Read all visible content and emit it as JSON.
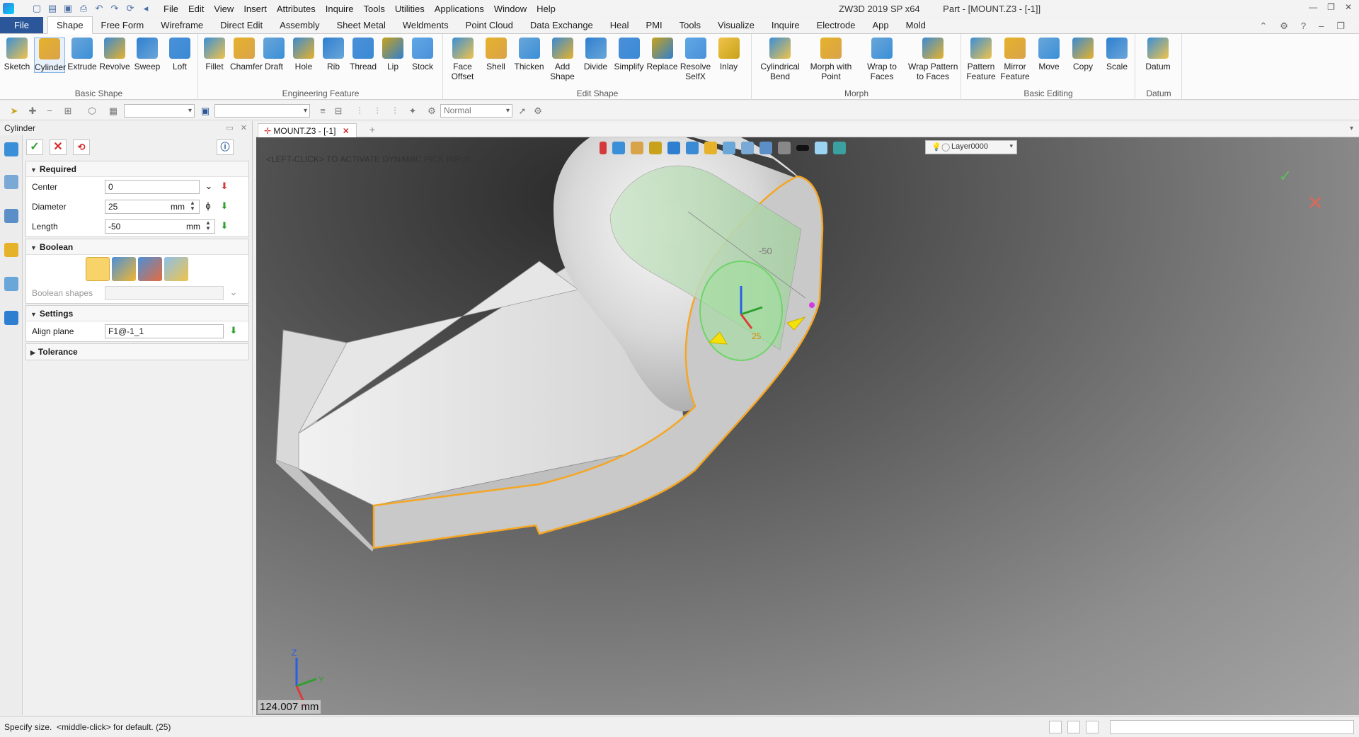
{
  "titlebar": {
    "menus": [
      "File",
      "Edit",
      "View",
      "Insert",
      "Attributes",
      "Inquire",
      "Tools",
      "Utilities",
      "Applications",
      "Window",
      "Help"
    ],
    "app_title": "ZW3D 2019 SP x64",
    "doc_title": "Part - [MOUNT.Z3 - [-1]]"
  },
  "ribbon_tabs": [
    "File",
    "Shape",
    "Free Form",
    "Wireframe",
    "Direct Edit",
    "Assembly",
    "Sheet Metal",
    "Weldments",
    "Point Cloud",
    "Data Exchange",
    "Heal",
    "PMI",
    "Tools",
    "Visualize",
    "Inquire",
    "Electrode",
    "App",
    "Mold"
  ],
  "ribbon": {
    "basic_shape": {
      "label": "Basic Shape",
      "tools": [
        "Sketch",
        "Cylinder",
        "Extrude",
        "Revolve",
        "Sweep",
        "Loft"
      ]
    },
    "engineering_feature": {
      "label": "Engineering Feature",
      "tools": [
        "Fillet",
        "Chamfer",
        "Draft",
        "Hole",
        "Rib",
        "Thread",
        "Lip",
        "Stock"
      ]
    },
    "edit_shape": {
      "label": "Edit Shape",
      "tools": [
        "Face\nOffset",
        "Shell",
        "Thicken",
        "Add\nShape",
        "Divide",
        "Simplify",
        "Replace",
        "Resolve\nSelfX",
        "Inlay"
      ]
    },
    "morph": {
      "label": "Morph",
      "tools": [
        "Cylindrical\nBend",
        "Morph with\nPoint",
        "Wrap to\nFaces",
        "Wrap Pattern\nto Faces"
      ]
    },
    "basic_editing": {
      "label": "Basic Editing",
      "tools": [
        "Pattern\nFeature",
        "Mirror\nFeature",
        "Move",
        "Copy",
        "Scale"
      ]
    },
    "datum": {
      "label": "Datum",
      "tools": [
        "Datum"
      ]
    }
  },
  "toolbar2": {
    "render_mode": "Normal"
  },
  "panel": {
    "title": "Cylinder",
    "required": {
      "header": "Required",
      "center_label": "Center",
      "center_value": "0",
      "diameter_label": "Diameter",
      "diameter_value": "25",
      "diameter_unit": "mm",
      "length_label": "Length",
      "length_value": "-50",
      "length_unit": "mm"
    },
    "boolean": {
      "header": "Boolean",
      "shapes_label": "Boolean shapes"
    },
    "settings": {
      "header": "Settings",
      "align_label": "Align plane",
      "align_value": "F1@-1_1"
    },
    "tolerance": {
      "header": "Tolerance"
    }
  },
  "doc_tab": {
    "name": "MOUNT.Z3 - [-1]"
  },
  "viewport": {
    "hint": "<LEFT-CLICK> TO ACTIVATE DYNAMIC PICK INPUT.",
    "layer": "Layer0000",
    "measure": "124.007 mm",
    "dim_length": "-50",
    "dim_diameter": "25",
    "axis_z": "Z",
    "axis_y": "Y",
    "axis_x": "X"
  },
  "status": {
    "text": "Specify size.  <middle-click> for default. (25)"
  },
  "colors": {
    "accent": "#2b579a",
    "highlight_edge": "#f5a623",
    "preview": "#8ee08e"
  }
}
